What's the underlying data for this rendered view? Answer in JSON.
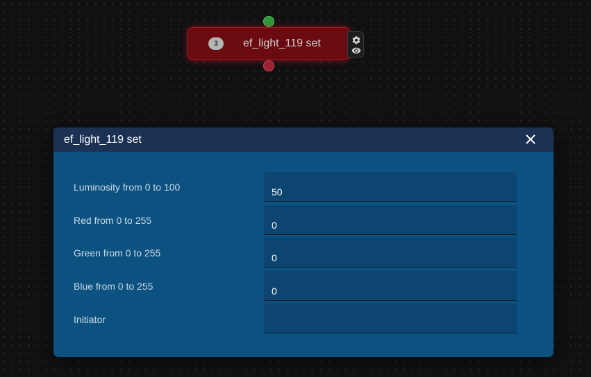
{
  "node": {
    "badge": "3",
    "title": "ef_light_119 set",
    "color": "#6b0a10",
    "input_handle_color": "#2e9b3c",
    "output_handle_color": "#9b2233",
    "tools": [
      "gear-icon",
      "eye-icon"
    ]
  },
  "dialog": {
    "title": "ef_light_119 set",
    "close_icon": "close-icon",
    "header_color": "#1b3255",
    "body_color": "#0c5280",
    "fields": [
      {
        "label": "Luminosity from 0 to 100",
        "value": "50"
      },
      {
        "label": "Red from 0 to 255",
        "value": "0"
      },
      {
        "label": "Green from 0 to 255",
        "value": "0"
      },
      {
        "label": "Blue from 0 to 255",
        "value": "0"
      },
      {
        "label": "Initiator",
        "value": ""
      }
    ]
  }
}
